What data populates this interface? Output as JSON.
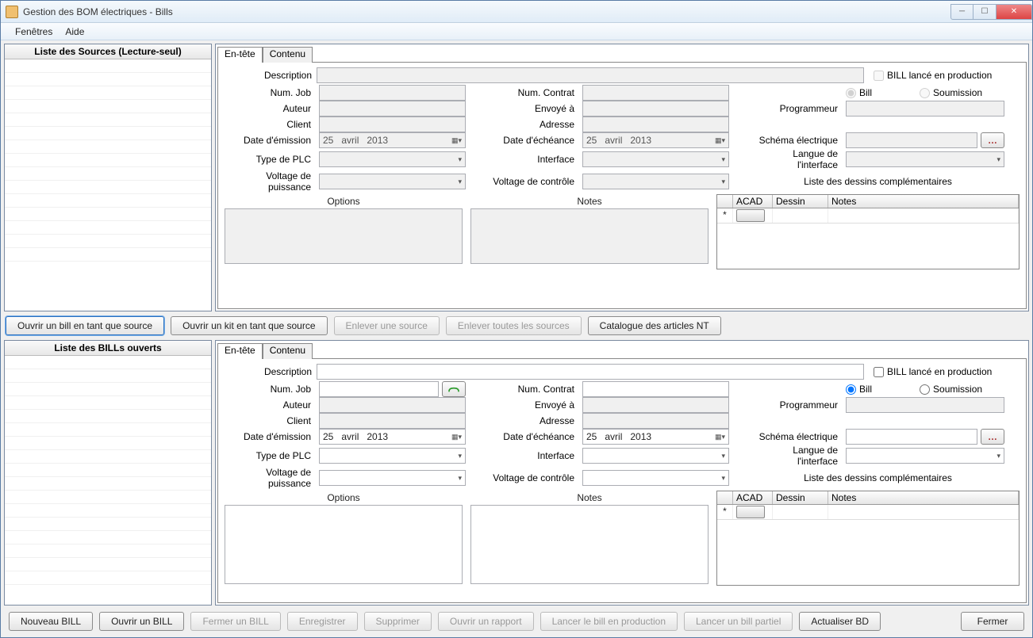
{
  "window": {
    "title": "Gestion des BOM électriques - Bills"
  },
  "menu": {
    "fenetres": "Fenêtres",
    "aide": "Aide"
  },
  "sources": {
    "header": "Liste des Sources (Lecture-seul)"
  },
  "bills": {
    "header": "Liste des BILLs ouverts"
  },
  "tabs": {
    "entete": "En-tête",
    "contenu": "Contenu"
  },
  "labels": {
    "description": "Description",
    "bill_prod": "BILL lancé en production",
    "numjob": "Num. Job",
    "numcontrat": "Num. Contrat",
    "bill": "Bill",
    "soumission": "Soumission",
    "auteur": "Auteur",
    "envoye": "Envoyé à",
    "programmeur": "Programmeur",
    "client": "Client",
    "adresse": "Adresse",
    "date_em": "Date d'émission",
    "date_ech": "Date d'échéance",
    "schema": "Schéma électrique",
    "type_plc": "Type de PLC",
    "interface": "Interface",
    "langue": "Langue de l'interface",
    "volt_pui": "Voltage de puissance",
    "volt_ctrl": "Voltage de contrôle",
    "liste_dess": "Liste des dessins complémentaires",
    "options": "Options",
    "notes": "Notes"
  },
  "date": {
    "day": "25",
    "month": "avril",
    "year": "2013"
  },
  "grid": {
    "acad": "ACAD",
    "dessin": "Dessin",
    "notes": "Notes"
  },
  "buttons": {
    "ouvrir_bill_src": "Ouvrir un bill en tant que source",
    "ouvrir_kit_src": "Ouvrir un kit en tant que source",
    "enlever_src": "Enlever une source",
    "enlever_all_src": "Enlever toutes les sources",
    "catalogue": "Catalogue des articles NT",
    "nouveau": "Nouveau BILL",
    "ouvrir": "Ouvrir un BILL",
    "fermer_bill": "Fermer un BILL",
    "enregistrer": "Enregistrer",
    "supprimer": "Supprimer",
    "rapport": "Ouvrir un rapport",
    "lancer_prod": "Lancer le bill en production",
    "lancer_part": "Lancer un bill partiel",
    "actualiser": "Actualiser BD",
    "fermer": "Fermer"
  }
}
